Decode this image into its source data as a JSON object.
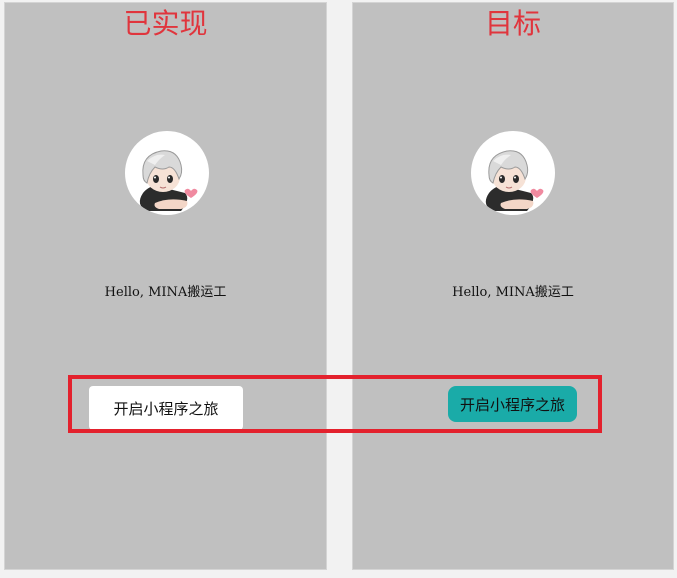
{
  "left_panel": {
    "caption": "已实现",
    "greeting": "Hello, MINA搬运工",
    "button_label": "开启小程序之旅"
  },
  "right_panel": {
    "caption": "目标",
    "greeting": "Hello, MINA搬运工",
    "button_label": "开启小程序之旅"
  },
  "colors": {
    "caption": "#e0353d",
    "panel_bg": "#c0c0c0",
    "target_button": "#1aaba8",
    "highlight": "#e3212d"
  },
  "icons": {
    "avatar": "cartoon-boy-avatar-icon",
    "heart": "heart-icon"
  }
}
